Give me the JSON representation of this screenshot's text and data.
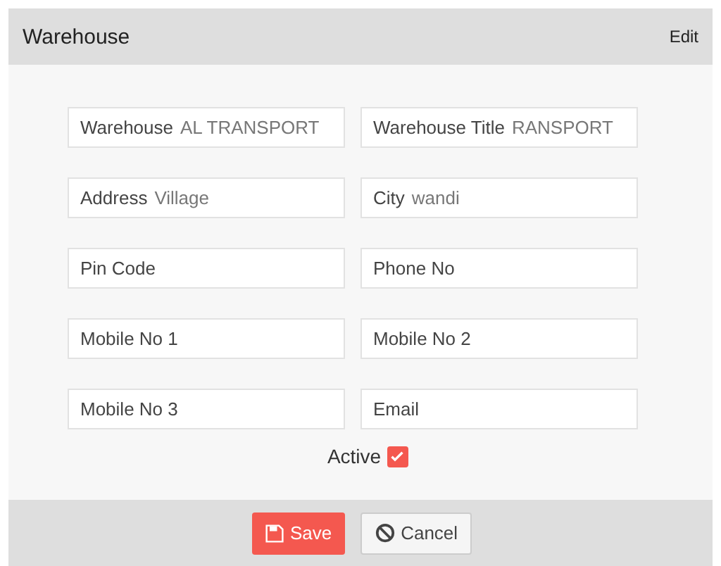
{
  "panel": {
    "title": "Warehouse",
    "edit_link": "Edit"
  },
  "fields": [
    {
      "label": "Warehouse",
      "value": "AL TRANSPORT"
    },
    {
      "label": "Warehouse Title",
      "value": "RANSPORT"
    },
    {
      "label": "Address",
      "value": "Village"
    },
    {
      "label": "City",
      "value": "wandi"
    },
    {
      "label": "Pin Code"
    },
    {
      "label": "Phone No"
    },
    {
      "label": "Mobile No 1"
    },
    {
      "label": "Mobile No 2"
    },
    {
      "label": "Mobile No 3"
    },
    {
      "label": "Email"
    }
  ],
  "active": {
    "label": "Active",
    "checked": true
  },
  "buttons": [
    {
      "kind": "save",
      "label": "Save"
    },
    {
      "kind": "cancel",
      "label": "Cancel"
    }
  ]
}
